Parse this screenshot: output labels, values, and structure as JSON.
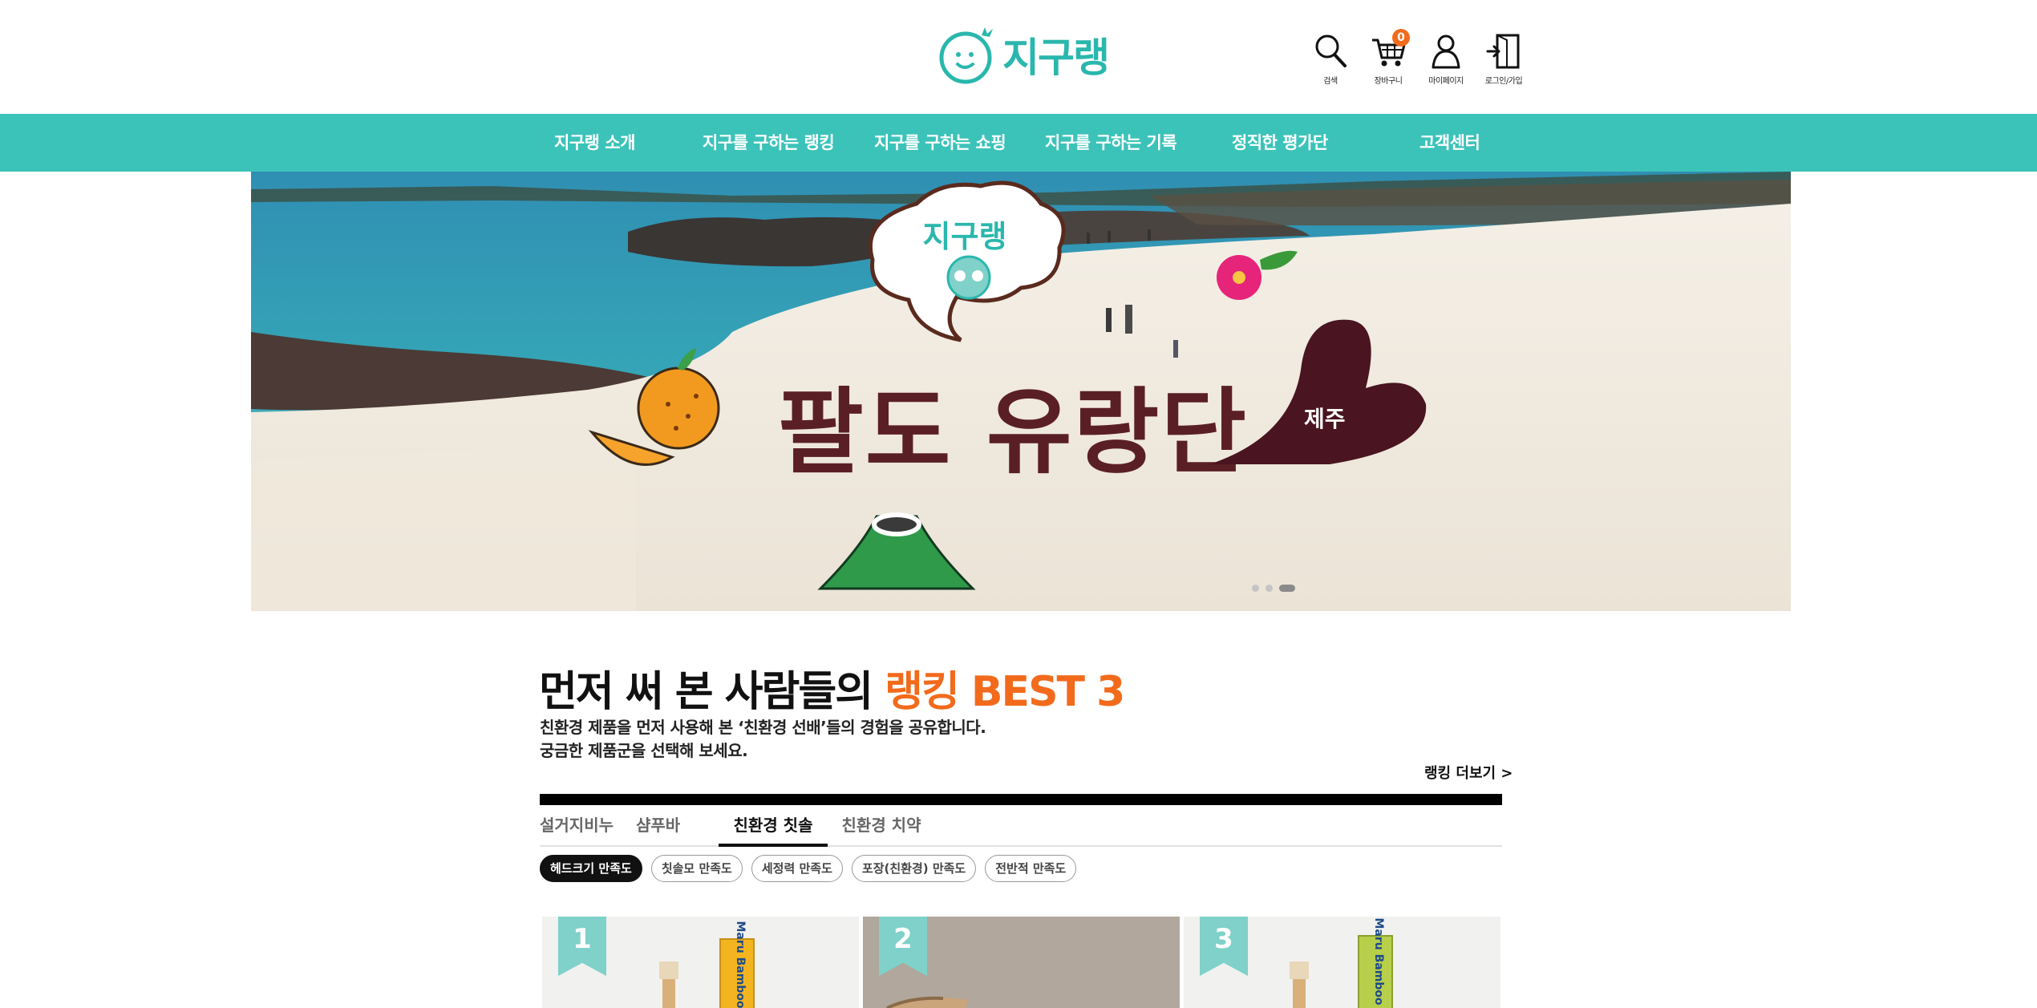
{
  "brand": {
    "name": "지구랭",
    "accent": "#3cc3b9",
    "highlight": "#f26a1b"
  },
  "header_icons": [
    {
      "icon": "search-icon",
      "label": "검색"
    },
    {
      "icon": "cart-icon",
      "label": "장바구니",
      "badge": "0"
    },
    {
      "icon": "mypage-icon",
      "label": "마이페이지"
    },
    {
      "icon": "login-icon",
      "label": "로그인/가입"
    }
  ],
  "nav": [
    "지구랭 소개",
    "지구를 구하는 랭킹",
    "지구를 구하는 쇼핑",
    "지구를 구하는 기록",
    "정직한 평가단",
    "고객센터"
  ],
  "hero": {
    "bubble_text": "지구랭",
    "headline": "팔도 유랑단",
    "region": "제주",
    "slides": 3,
    "active_slide": 3
  },
  "ranking": {
    "title_prefix": "먼저 써 본 사람들의",
    "title_highlight": "랭킹 BEST 3",
    "desc_line1": "친환경 제품을 먼저 사용해 본 ‘친환경 선배’들의 경험을 공유합니다.",
    "desc_line2": "궁금한 제품군을 선택해 보세요.",
    "more_label": "랭킹 더보기 >",
    "tabs": [
      "설거지비누",
      "샴푸바",
      "친환경 칫솔",
      "친환경 치약"
    ],
    "active_tab": 2,
    "filters": [
      "헤드크기 만족도",
      "칫솔모 만족도",
      "세정력 만족도",
      "포장(친환경) 만족도",
      "전반적 만족도"
    ],
    "active_filter": 0,
    "cards": [
      {
        "rank": "1",
        "product_text": "Maru Bamboo"
      },
      {
        "rank": "2"
      },
      {
        "rank": "3",
        "product_text": "Maru Bamboo"
      }
    ]
  }
}
